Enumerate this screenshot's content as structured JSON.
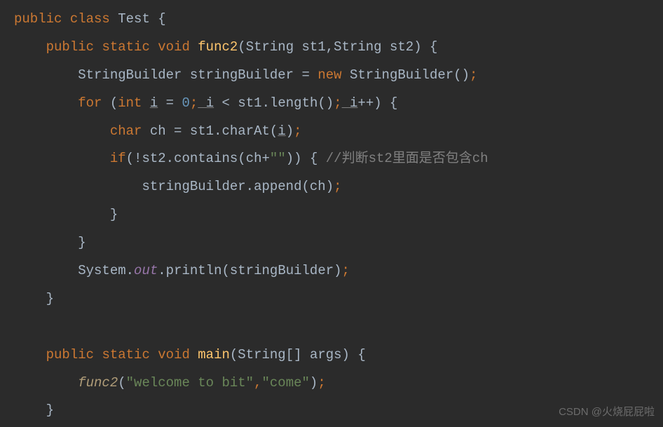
{
  "code": {
    "line1": {
      "kw_public": "public",
      "kw_class": "class",
      "class_name": "Test",
      "brace": " {"
    },
    "line2": {
      "kw_public": "public",
      "kw_static": "static",
      "kw_void": "void",
      "method_name": "func2",
      "param_type1": "String",
      "param_name1": "st1",
      "comma": ",",
      "param_type2": "String",
      "param_name2": "st2",
      "brace": ") {"
    },
    "line3": {
      "type": "StringBuilder",
      "var_name": "stringBuilder",
      "eq": " = ",
      "kw_new": "new",
      "ctor": "StringBuilder",
      "parens": "()",
      "semi": ";"
    },
    "line4": {
      "kw_for": "for",
      "open": " (",
      "kw_int": "int",
      "var_i": "i",
      "eq": " = ",
      "zero": "0",
      "semi1": ";",
      "cond_i": " i",
      "lt": " < ",
      "st1": "st1",
      "dot": ".",
      "length": "length",
      "parens": "()",
      "semi2": ";",
      "inc_i": " i",
      "plusplus": "++",
      "close": ") {"
    },
    "line5": {
      "kw_char": "char",
      "var_ch": "ch",
      "eq": " = ",
      "st1": "st1",
      "dot": ".",
      "charAt": "charAt",
      "open": "(",
      "arg_i": "i",
      "close": ")",
      "semi": ";"
    },
    "line6": {
      "kw_if": "if",
      "open": "(",
      "not": "!",
      "st2": "st2",
      "dot": ".",
      "contains": "contains",
      "open2": "(",
      "ch": "ch",
      "plus": "+",
      "empty_str": "\"\"",
      "close2": "))",
      "brace": " { ",
      "comment": "//判断st2里面是否包含ch"
    },
    "line7": {
      "var": "stringBuilder",
      "dot": ".",
      "append": "append",
      "open": "(",
      "ch": "ch",
      "close": ")",
      "semi": ";"
    },
    "line8": {
      "brace": "}"
    },
    "line9": {
      "brace": "}"
    },
    "line10": {
      "sys": "System",
      "dot1": ".",
      "out": "out",
      "dot2": ".",
      "println": "println",
      "open": "(",
      "arg": "stringBuilder",
      "close": ")",
      "semi": ";"
    },
    "line11": {
      "brace": "}"
    },
    "line13": {
      "kw_public": "public",
      "kw_static": "static",
      "kw_void": "void",
      "method_name": "main",
      "param_type": "String",
      "brackets": "[]",
      "param_name": "args",
      "brace": ") {"
    },
    "line14": {
      "func_call": "func2",
      "open": "(",
      "str1": "\"welcome to bit\"",
      "comma": ",",
      "str2": "\"come\"",
      "close": ")",
      "semi": ";"
    },
    "line15": {
      "brace": "}"
    }
  },
  "watermark": "CSDN @火烧屁屁啦"
}
